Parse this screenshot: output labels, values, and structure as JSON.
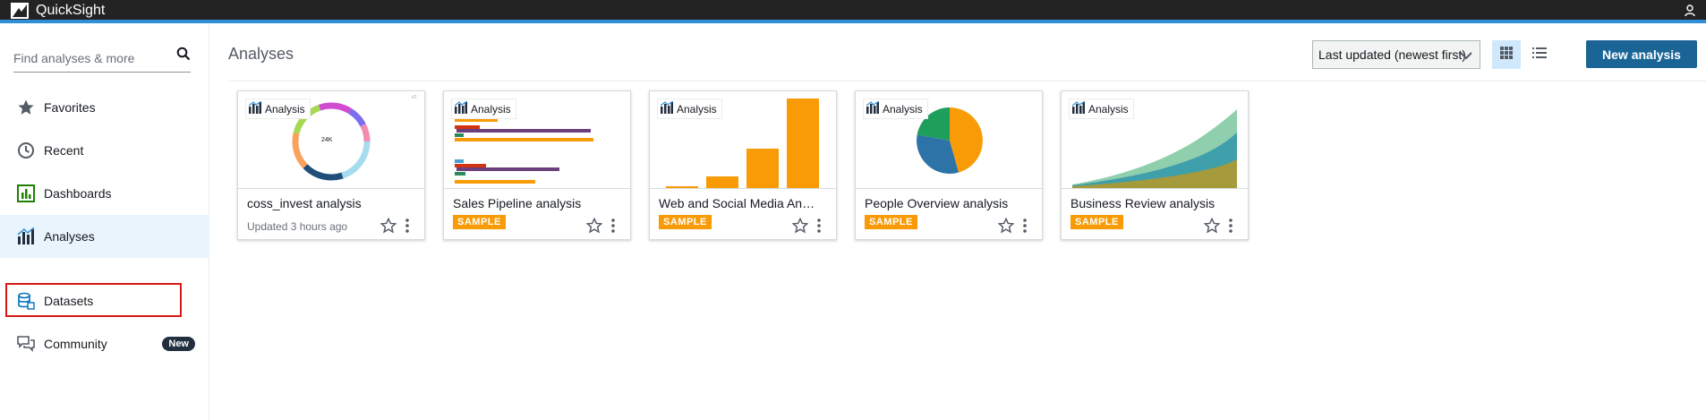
{
  "app": {
    "name": "QuickSight"
  },
  "sidebar": {
    "search_placeholder": "Find analyses & more",
    "items": [
      {
        "label": "Favorites",
        "icon": "star-icon"
      },
      {
        "label": "Recent",
        "icon": "clock-icon"
      },
      {
        "label": "Dashboards",
        "icon": "bar-chart-icon"
      },
      {
        "label": "Analyses",
        "icon": "analysis-icon"
      },
      {
        "label": "Datasets",
        "icon": "database-icon"
      },
      {
        "label": "Community",
        "icon": "chat-icon",
        "badge": "New"
      }
    ]
  },
  "header": {
    "title": "Analyses",
    "sort_value": "Last updated (newest first)",
    "new_button": "New analysis"
  },
  "cards": [
    {
      "tag": "Analysis",
      "title": "coss_invest analysis",
      "meta": "Updated 3 hours ago",
      "donut_center": "24K"
    },
    {
      "tag": "Analysis",
      "title": "Sales Pipeline analysis",
      "badge": "SAMPLE"
    },
    {
      "tag": "Analysis",
      "title": "Web and Social Media Anal…",
      "badge": "SAMPLE"
    },
    {
      "tag": "Analysis",
      "title": "People Overview analysis",
      "badge": "SAMPLE"
    },
    {
      "tag": "Analysis",
      "title": "Business Review analysis",
      "badge": "SAMPLE"
    }
  ],
  "colors": {
    "accent": "#1a6596",
    "sample": "#f89b06",
    "topbar": "#232323",
    "active_nav": "#eaf4fc",
    "highlight": "#d91515"
  }
}
